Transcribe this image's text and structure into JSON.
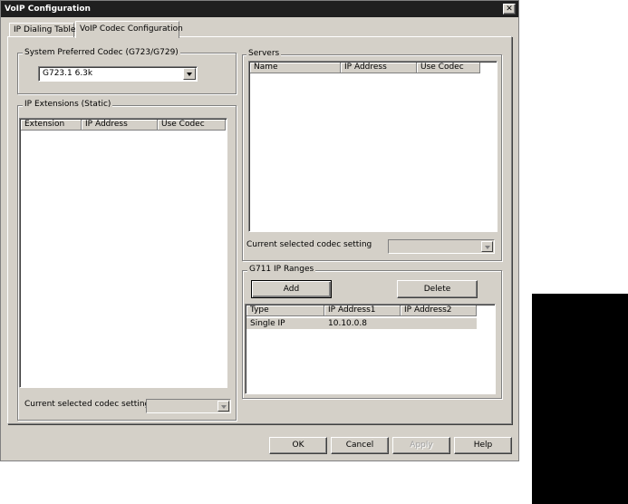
{
  "window": {
    "title": "VoIP Configuration",
    "close_glyph": "✕"
  },
  "tabs": [
    {
      "label": "IP Dialing Table",
      "active": false
    },
    {
      "label": "VoIP Codec Configuration",
      "active": true
    }
  ],
  "preferred_codec": {
    "group_label": "System Preferred Codec (G723/G729)",
    "selected_value": "G723.1 6.3k"
  },
  "ip_extensions": {
    "group_label": "IP Extensions (Static)",
    "columns": [
      "Extension",
      "IP Address",
      "Use Codec"
    ],
    "rows": [],
    "codec_setting_label": "Current selected codec setting",
    "codec_setting_value": ""
  },
  "servers": {
    "group_label": "Servers",
    "columns": [
      "Name",
      "IP Address",
      "Use Codec"
    ],
    "rows": [],
    "codec_setting_label": "Current selected codec setting",
    "codec_setting_value": ""
  },
  "g711": {
    "group_label": "G711 IP Ranges",
    "add_label": "Add",
    "delete_label": "Delete",
    "columns": [
      "Type",
      "IP Address1",
      "IP Address2"
    ],
    "rows": [
      {
        "type": "Single IP",
        "ip1": "10.10.0.8",
        "ip2": ""
      }
    ]
  },
  "buttons": {
    "ok": "OK",
    "cancel": "Cancel",
    "apply": "Apply",
    "help": "Help"
  },
  "colors": {
    "dialog_bg": "#d4d0c8",
    "titlebar": "#1f1f1f",
    "selection_row": "#d4d0c8",
    "side_panel": "#000000"
  }
}
